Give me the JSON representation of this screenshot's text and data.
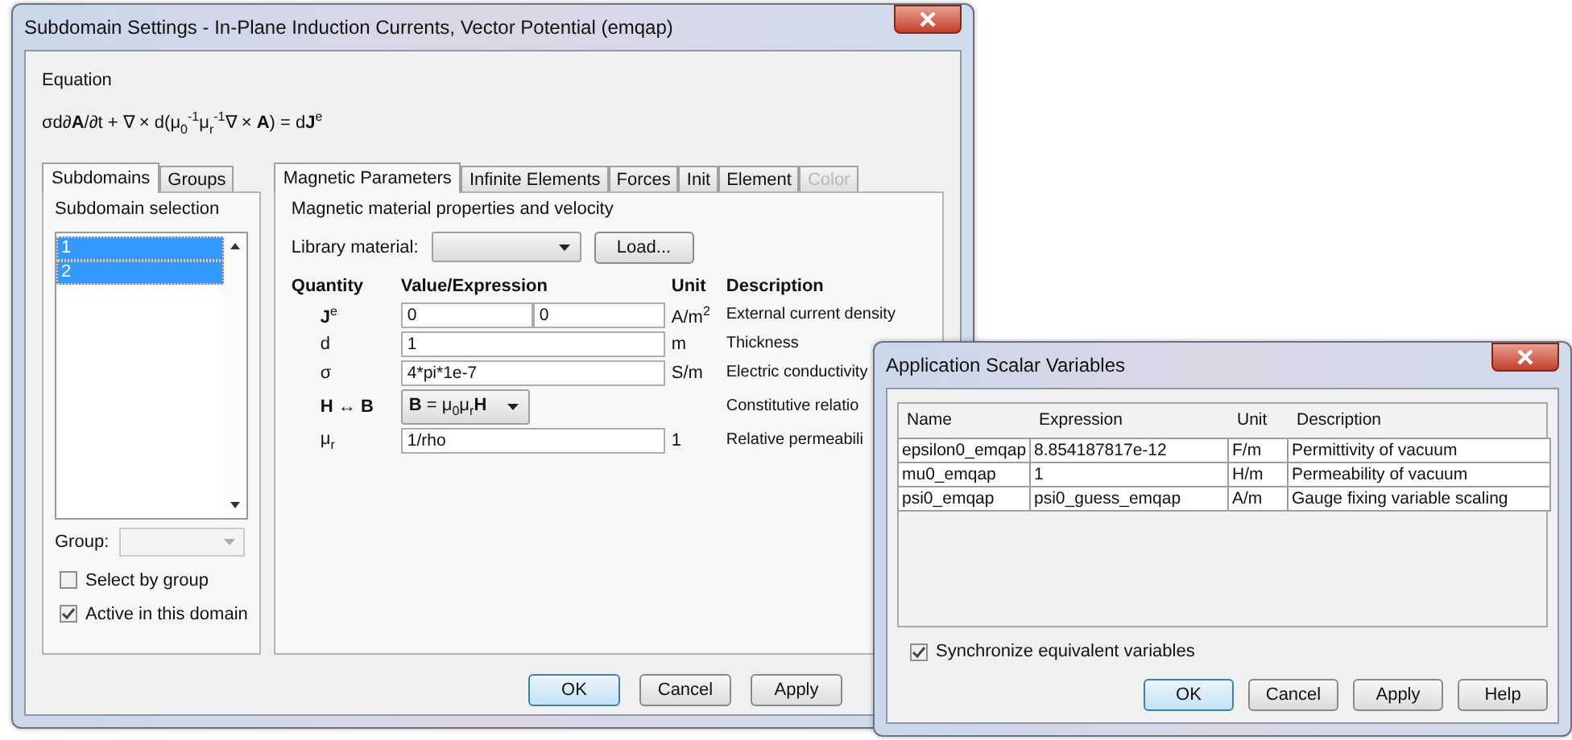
{
  "main_window": {
    "title": "Subdomain Settings - In-Plane Induction Currents, Vector Potential (emqap)",
    "equation_label": "Equation",
    "equation": "σd∂**A**/∂t + ∇ × d(μ$_{0}$$^{-1}$μ$_{r}$$^{-1}$∇ × **A**) = d**J**$^{e}$",
    "left_tabs": [
      {
        "label": "Subdomains",
        "selected": true
      },
      {
        "label": "Groups",
        "selected": false
      }
    ],
    "subdomain_selection_label": "Subdomain selection",
    "subdomains": [
      {
        "label": "1",
        "selected": true
      },
      {
        "label": "2",
        "selected": true
      }
    ],
    "group_label": "Group:",
    "checkboxes": [
      {
        "label": "Select by group",
        "checked": false
      },
      {
        "label": "Active in this domain",
        "checked": true
      }
    ],
    "right_tabs": [
      {
        "label": "Magnetic Parameters",
        "selected": true,
        "disabled": false
      },
      {
        "label": "Infinite Elements",
        "selected": false,
        "disabled": false
      },
      {
        "label": "Forces",
        "selected": false,
        "disabled": false
      },
      {
        "label": "Init",
        "selected": false,
        "disabled": false
      },
      {
        "label": "Element",
        "selected": false,
        "disabled": false
      },
      {
        "label": "Color",
        "selected": false,
        "disabled": true
      }
    ],
    "section_title": "Magnetic material properties and velocity",
    "library_label": "Library material:",
    "load_button": "Load...",
    "columns": [
      "Quantity",
      "Value/Expression",
      "Unit",
      "Description"
    ],
    "rows": [
      {
        "kind": "pair",
        "quantity": "**J**$^{e}$",
        "values": [
          "0",
          "0"
        ],
        "unit": "A/m$^{2}$",
        "description": "External current density"
      },
      {
        "kind": "field",
        "quantity": "d",
        "values": [
          "1"
        ],
        "unit": "m",
        "description": "Thickness"
      },
      {
        "kind": "field",
        "quantity": "σ",
        "values": [
          "4*pi*1e-7"
        ],
        "unit": "S/m",
        "description": "Electric conductivity"
      },
      {
        "kind": "select",
        "quantity": "**H** ↔ **B**",
        "values": [
          "**B** = μ$_{0}$μ$_{r}$**H**"
        ],
        "description": "Constitutive relatio"
      },
      {
        "kind": "field",
        "quantity": "μ$_{r}$",
        "values": [
          "1/rho"
        ],
        "unit": "1",
        "description": "Relative permeabili"
      }
    ],
    "buttons": [
      "OK",
      "Cancel",
      "Apply"
    ]
  },
  "scalar_window": {
    "title": "Application Scalar Variables",
    "columns": [
      "Name",
      "Expression",
      "Unit",
      "Description"
    ],
    "rows": [
      [
        "epsilon0_emqap",
        "8.854187817e-12",
        "F/m",
        "Permittivity of vacuum"
      ],
      [
        "mu0_emqap",
        "1",
        "H/m",
        "Permeability of vacuum"
      ],
      [
        "psi0_emqap",
        "psi0_guess_emqap",
        "A/m",
        "Gauge fixing variable scaling"
      ]
    ],
    "sync": {
      "label": "Synchronize equivalent variables",
      "checked": true
    },
    "buttons": [
      "OK",
      "Cancel",
      "Apply",
      "Help"
    ]
  }
}
